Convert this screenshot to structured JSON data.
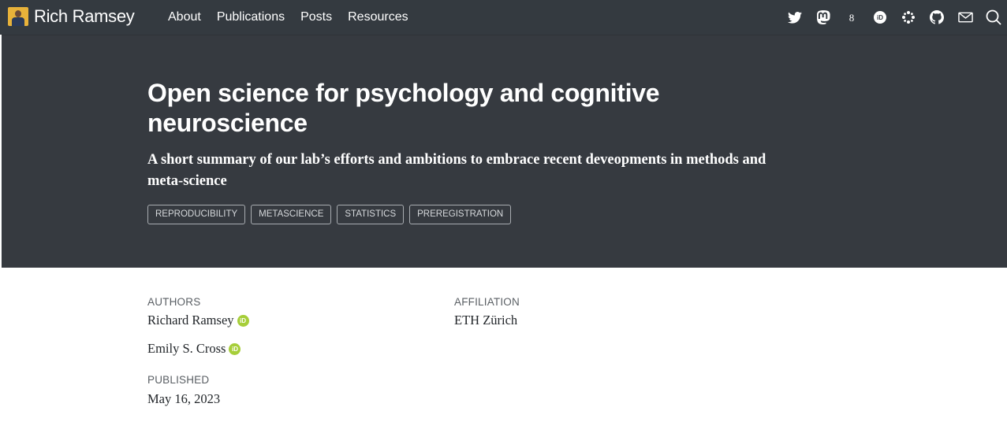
{
  "navbar": {
    "brand_title": "Rich Ramsey",
    "links": [
      "About",
      "Publications",
      "Posts",
      "Resources"
    ],
    "icons": [
      "twitter-icon",
      "mastodon-icon",
      "google-scholar-icon",
      "orcid-icon",
      "osf-icon",
      "github-icon",
      "email-icon",
      "search-icon"
    ]
  },
  "banner": {
    "title": "Open science for psychology and cognitive neuroscience",
    "subtitle": "A short summary of our lab’s efforts and ambitions to embrace recent deveopments in methods and meta-science",
    "tags": [
      "REPRODUCIBILITY",
      "METASCIENCE",
      "STATISTICS",
      "PREREGISTRATION"
    ]
  },
  "meta": {
    "authors_label": "AUTHORS",
    "authors": [
      "Richard Ramsey",
      "Emily S. Cross"
    ],
    "affiliation_label": "AFFILIATION",
    "affiliation": "ETH Zürich",
    "published_label": "PUBLISHED",
    "published": "May 16, 2023"
  },
  "colors": {
    "navbar_bg": "#343a40",
    "banner_bg": "#363a40",
    "orcid_green": "#a6ce39"
  }
}
